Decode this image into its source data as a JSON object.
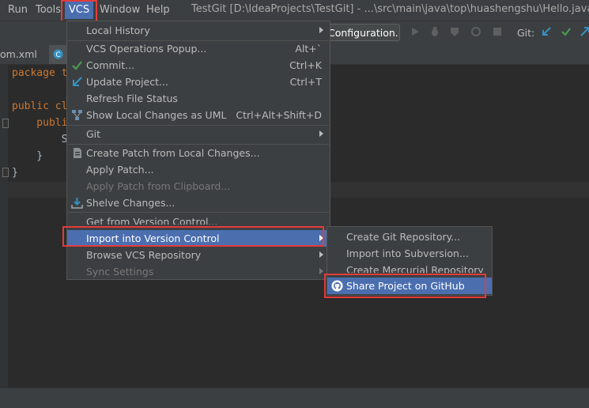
{
  "menubar": {
    "items": [
      "Run",
      "Tools",
      "VCS",
      "Window",
      "Help"
    ],
    "title": "TestGit [D:\\IdeaProjects\\TestGit] - ...\\src\\main\\java\\top\\huashengshu\\Hello.java"
  },
  "toolbar": {
    "run_config": "Configuration...",
    "git_label": "Git:"
  },
  "tabs": {
    "file_tab": "om.xml"
  },
  "editor": {
    "lines": [
      "package t",
      "",
      "public cl",
      "    publi",
      "        S",
      "    }",
      "}"
    ]
  },
  "vcs_menu": {
    "items": [
      {
        "label": "Local History",
        "shortcut": "",
        "submenu": true
      },
      {
        "label": "VCS Operations Popup...",
        "shortcut": "Alt+`"
      },
      {
        "label": "Commit...",
        "shortcut": "Ctrl+K",
        "icon": "commit-check-icon"
      },
      {
        "label": "Update Project...",
        "shortcut": "Ctrl+T",
        "icon": "update-arrow-icon"
      },
      {
        "label": "Refresh File Status",
        "shortcut": ""
      },
      {
        "label": "Show Local Changes as UML",
        "shortcut": "Ctrl+Alt+Shift+D",
        "icon": "uml-diagram-icon"
      },
      {
        "label": "Git",
        "shortcut": "",
        "submenu": true
      },
      {
        "label": "Create Patch from Local Changes...",
        "shortcut": "",
        "icon": "patch-file-icon"
      },
      {
        "label": "Apply Patch...",
        "shortcut": ""
      },
      {
        "label": "Apply Patch from Clipboard...",
        "shortcut": "",
        "disabled": true
      },
      {
        "label": "Shelve Changes...",
        "shortcut": "",
        "icon": "shelve-icon"
      },
      {
        "label": "Get from Version Control...",
        "shortcut": ""
      },
      {
        "label": "Import into Version Control",
        "shortcut": "",
        "submenu": true,
        "selected": true
      },
      {
        "label": "Browse VCS Repository",
        "shortcut": "",
        "submenu": true
      },
      {
        "label": "Sync Settings",
        "shortcut": "",
        "submenu": true,
        "disabled": true
      }
    ]
  },
  "import_submenu": {
    "items": [
      {
        "label": "Create Git Repository..."
      },
      {
        "label": "Import into Subversion..."
      },
      {
        "label": "Create Mercurial Repository"
      },
      {
        "label": "Share Project on GitHub",
        "selected": true,
        "icon": "github-icon"
      }
    ]
  },
  "colors": {
    "selection": "#4b6eaf",
    "highlight_box": "#e33b3b",
    "menu_bg": "#3c3f41",
    "editor_bg": "#2b2b2b"
  }
}
